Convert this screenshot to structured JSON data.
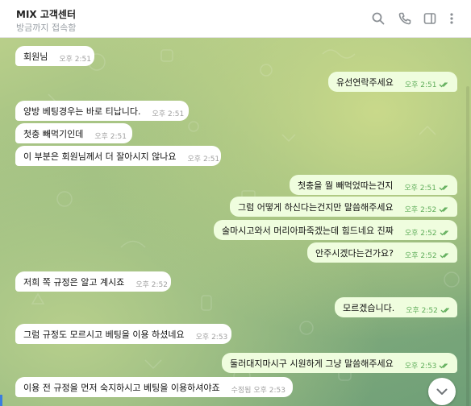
{
  "header": {
    "title": "MIX 고객센터",
    "status": "방금까지 접속함",
    "icons": [
      "search-icon",
      "phone-icon",
      "sidebar-toggle-icon",
      "more-vertical-icon"
    ]
  },
  "messages": [
    {
      "dir": "in",
      "text": "회원님",
      "time": "오후 2:51"
    },
    {
      "dir": "out",
      "text": "유선연락주세요",
      "time": "오후 2:51"
    },
    {
      "dir": "in",
      "text": "양방 베팅경우는 바로 티납니다.",
      "time": "오후 2:51"
    },
    {
      "dir": "in",
      "text": "첫충 빼먹기인데",
      "time": "오후 2:51"
    },
    {
      "dir": "in",
      "text": "이 부분은 회원님께서 더 잘아시지 않나요",
      "time": "오후 2:51"
    },
    {
      "dir": "out",
      "text": "첫충을 뭘 빼먹었따는건지",
      "time": "오후 2:51"
    },
    {
      "dir": "out",
      "text": "그럼 어떻게 하신다는건지만 말씀해주세요",
      "time": "오후 2:52"
    },
    {
      "dir": "out",
      "text": "술마시고와서 머리아파죽겠는데 힘드네요 진짜",
      "time": "오후 2:52"
    },
    {
      "dir": "out",
      "text": "안주시겠다는건가요?",
      "time": "오후 2:52"
    },
    {
      "dir": "in",
      "text": "저희 쪽 규정은 알고 계시죠",
      "time": "오후 2:52"
    },
    {
      "dir": "out",
      "text": "모르겠습니다.",
      "time": "오후 2:52"
    },
    {
      "dir": "in",
      "text": "그럼 규정도 모르시고 베팅을 이용 하셨네요",
      "time": "오후 2:53"
    },
    {
      "dir": "out",
      "text": "둘러대지마시구 시원하게 그냥 말씀해주세요",
      "time": "오후 2:53"
    },
    {
      "dir": "in",
      "text": "이용 전 규정을 먼저 숙지하시고 베팅을 이용하셔야죠",
      "time": "수정됨 오후 2:53"
    }
  ],
  "colors": {
    "incoming_bubble": "#ffffff",
    "outgoing_bubble": "#effdde",
    "read_check": "#5fad5a"
  }
}
